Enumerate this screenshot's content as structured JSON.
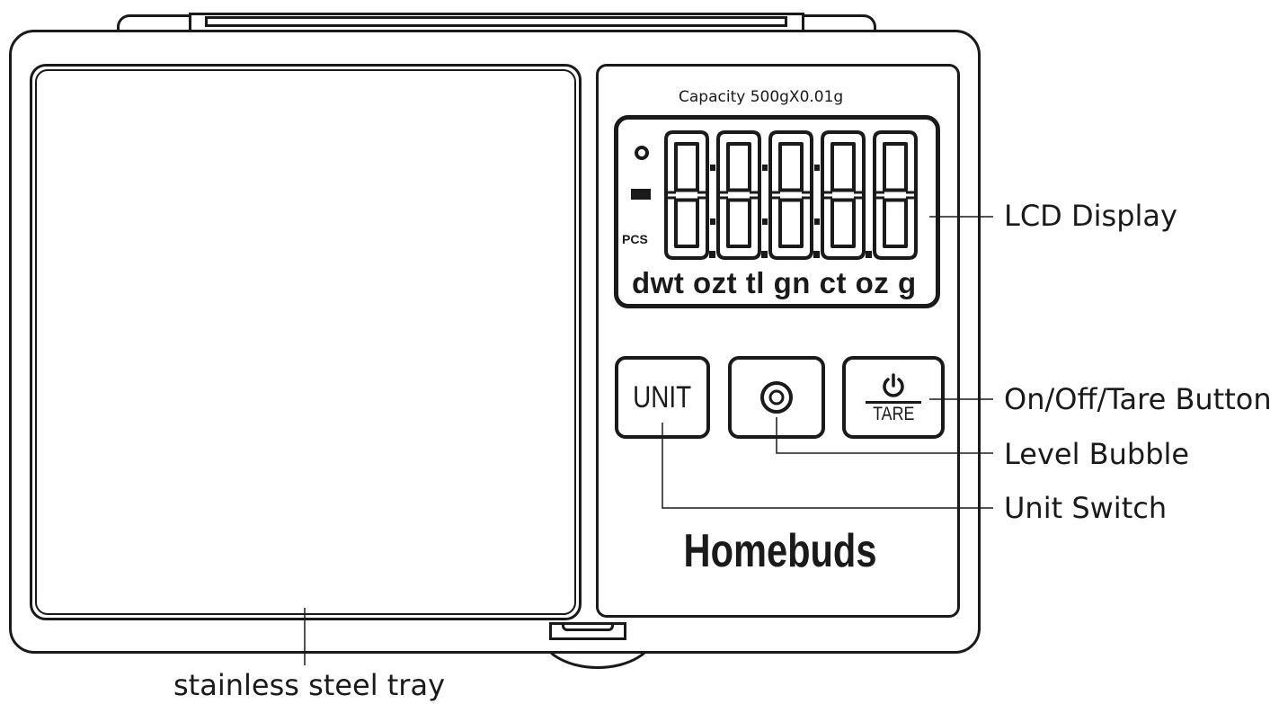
{
  "device": {
    "capacity_text": "Capacity  500gX0.01g",
    "lcd": {
      "digits": "88888",
      "minus_sign": "-",
      "pcs_label": "PCS",
      "unit_row": "dwt ozt tl gn ct oz  g"
    },
    "buttons": {
      "unit_label": "UNIT",
      "tare_label": "TARE",
      "power_icon": "power-icon",
      "level_icon": "level-bubble-icon"
    },
    "brand": "Homebuds"
  },
  "callouts": {
    "lcd_display": "LCD Display",
    "on_off_tare": "On/Off/Tare Button",
    "level_bubble": "Level Bubble",
    "unit_switch": "Unit Switch",
    "tray": "stainless steel tray"
  }
}
